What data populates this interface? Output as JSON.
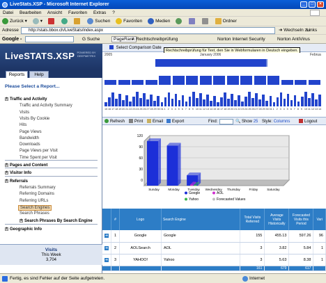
{
  "window": {
    "title": "LiveStats.XSP - Microsoft Internet Explorer"
  },
  "menu": [
    "Datei",
    "Bearbeiten",
    "Ansicht",
    "Favoriten",
    "Extras",
    "?"
  ],
  "toolbar": {
    "back": "Zurück",
    "search": "Suchen",
    "favorites": "Favoriten",
    "media": "Medien",
    "folder": "Ordner"
  },
  "address": {
    "label": "Adresse",
    "url": "http://stats.bbox.ch/LiveStats/index.aspx",
    "go": "Wechseln zu",
    "links": "Links"
  },
  "googlebar": {
    "logo": "Google -",
    "search": "Suche",
    "pagerank": "PageRank",
    "spellcheck": "Rechtschreibprüfung",
    "norton_security": "Norton Internet Security",
    "norton_antivirus": "Norton AntiVirus"
  },
  "app": {
    "logo": "LiveSTATS.XSP",
    "powered_by": "POWERED BY DEEPMETRIX",
    "tabs": [
      "Reports",
      "Help"
    ],
    "select_report": "Please Select a Report...",
    "tree": [
      {
        "label": "Traffic and Activity",
        "type": "sec"
      },
      {
        "label": "Traffic and Activity Summary",
        "type": "sub"
      },
      {
        "label": "Visits",
        "type": "sub"
      },
      {
        "label": "Visits By Cookie",
        "type": "sub"
      },
      {
        "label": "Hits",
        "type": "sub"
      },
      {
        "label": "Page Views",
        "type": "sub"
      },
      {
        "label": "Bandwidth",
        "type": "sub"
      },
      {
        "label": "Downloads",
        "type": "sub"
      },
      {
        "label": "Page Views per Visit",
        "type": "sub"
      },
      {
        "label": "Time Spent per Visit",
        "type": "sub"
      },
      {
        "label": "Pages and Content",
        "type": "sec"
      },
      {
        "label": "Visitor Info",
        "type": "sec"
      },
      {
        "label": "Referrals",
        "type": "sec"
      },
      {
        "label": "Referrals Summary",
        "type": "sub"
      },
      {
        "label": "Referring Domains",
        "type": "sub"
      },
      {
        "label": "Referring URLs",
        "type": "sub"
      },
      {
        "label": "Search Engines",
        "type": "sel"
      },
      {
        "label": "Search Phrases",
        "type": "sub"
      },
      {
        "label": "Search Phrases By Search Engine",
        "type": "sec2"
      },
      {
        "label": "Geographic Info",
        "type": "sec"
      }
    ],
    "visits": {
      "title": "Visits",
      "period": "This Week",
      "value": "3,704"
    },
    "select_comparison": "Select Comparison Date",
    "tooltip": "Rechtschreibprüfung für Text, den Sie in Webformularen in Deutsch eingeben.",
    "timeline": {
      "year_left": "2005",
      "month": "January 2006",
      "month_right": "Februa",
      "days": [
        "15",
        "16",
        "17",
        "18",
        "19",
        "20",
        "21",
        "22",
        "23",
        "24",
        "25",
        "26",
        "27",
        "28",
        "29",
        "30",
        "31",
        "1",
        "2",
        "3",
        "4",
        "5",
        "6",
        "7",
        "8",
        "9",
        "10",
        "11",
        "12",
        "13",
        "14",
        "15",
        "16",
        "17",
        "18",
        "19",
        "20",
        "21",
        "22",
        "23",
        "24",
        "25",
        "26",
        "27",
        "28",
        "29",
        "30",
        "31",
        "1",
        "2",
        "3",
        "4",
        "5",
        "6",
        "7",
        "8",
        "9",
        "10",
        "11",
        "12",
        "13",
        "14"
      ]
    },
    "actions": {
      "refresh": "Refresh",
      "print": "Print",
      "email": "Email",
      "export": "Export",
      "find": "Find:",
      "show": "Show",
      "show_count": "25",
      "style": "Style:",
      "style_value": "Columns",
      "logout": "Logout"
    },
    "accent_color": "#2d7dc6"
  },
  "chart_data": {
    "type": "bar",
    "categories": [
      "Sunday",
      "Monday",
      "Tuesday",
      "Wednesday",
      "Thursday",
      "Friday",
      "Saturday"
    ],
    "series": [
      {
        "name": "Google",
        "values": [
          120,
          108,
          28,
          0,
          0,
          0,
          0
        ],
        "color": "#1c2fd8"
      },
      {
        "name": "AOL",
        "values": [
          0,
          0,
          3,
          0,
          0,
          0,
          0
        ],
        "color": "#d02fd0"
      },
      {
        "name": "Yahoo",
        "values": [
          0,
          0,
          2,
          0,
          0,
          0,
          0
        ],
        "color": "#39b54a"
      },
      {
        "name": "Forecasted Values",
        "values": [
          0,
          0,
          0,
          0,
          0,
          0,
          0
        ],
        "color": "#c0c0c0"
      }
    ],
    "yticks": [
      "120",
      "90",
      "60",
      "30",
      "0"
    ],
    "ylim": [
      0,
      120
    ]
  },
  "table": {
    "headers": [
      "#",
      "Logo",
      "Search Engine",
      "Total Visits Referred",
      "Average Visits Historically",
      "Forecasted Visits this Period",
      "Vari"
    ],
    "rows": [
      {
        "num": "1",
        "logo": "Google",
        "engine": "Google",
        "total": "155",
        "avg": "455.13",
        "forecast": "597.26",
        "var": "96"
      },
      {
        "num": "2",
        "logo": "AOLSearch",
        "engine": "AOL",
        "total": "3",
        "avg": "3.82",
        "forecast": "5.84",
        "var": "1"
      },
      {
        "num": "3",
        "logo": "YAHOO!",
        "engine": "Yahoo",
        "total": "3",
        "avg": "5.63",
        "forecast": "8.38",
        "var": "1"
      }
    ],
    "totals": {
      "total": "161",
      "avg": "679",
      "forecast": "617"
    }
  },
  "status": {
    "text": "Fertig, es sind Fehler auf der Seite aufgetreten.",
    "zone": "Internet"
  }
}
